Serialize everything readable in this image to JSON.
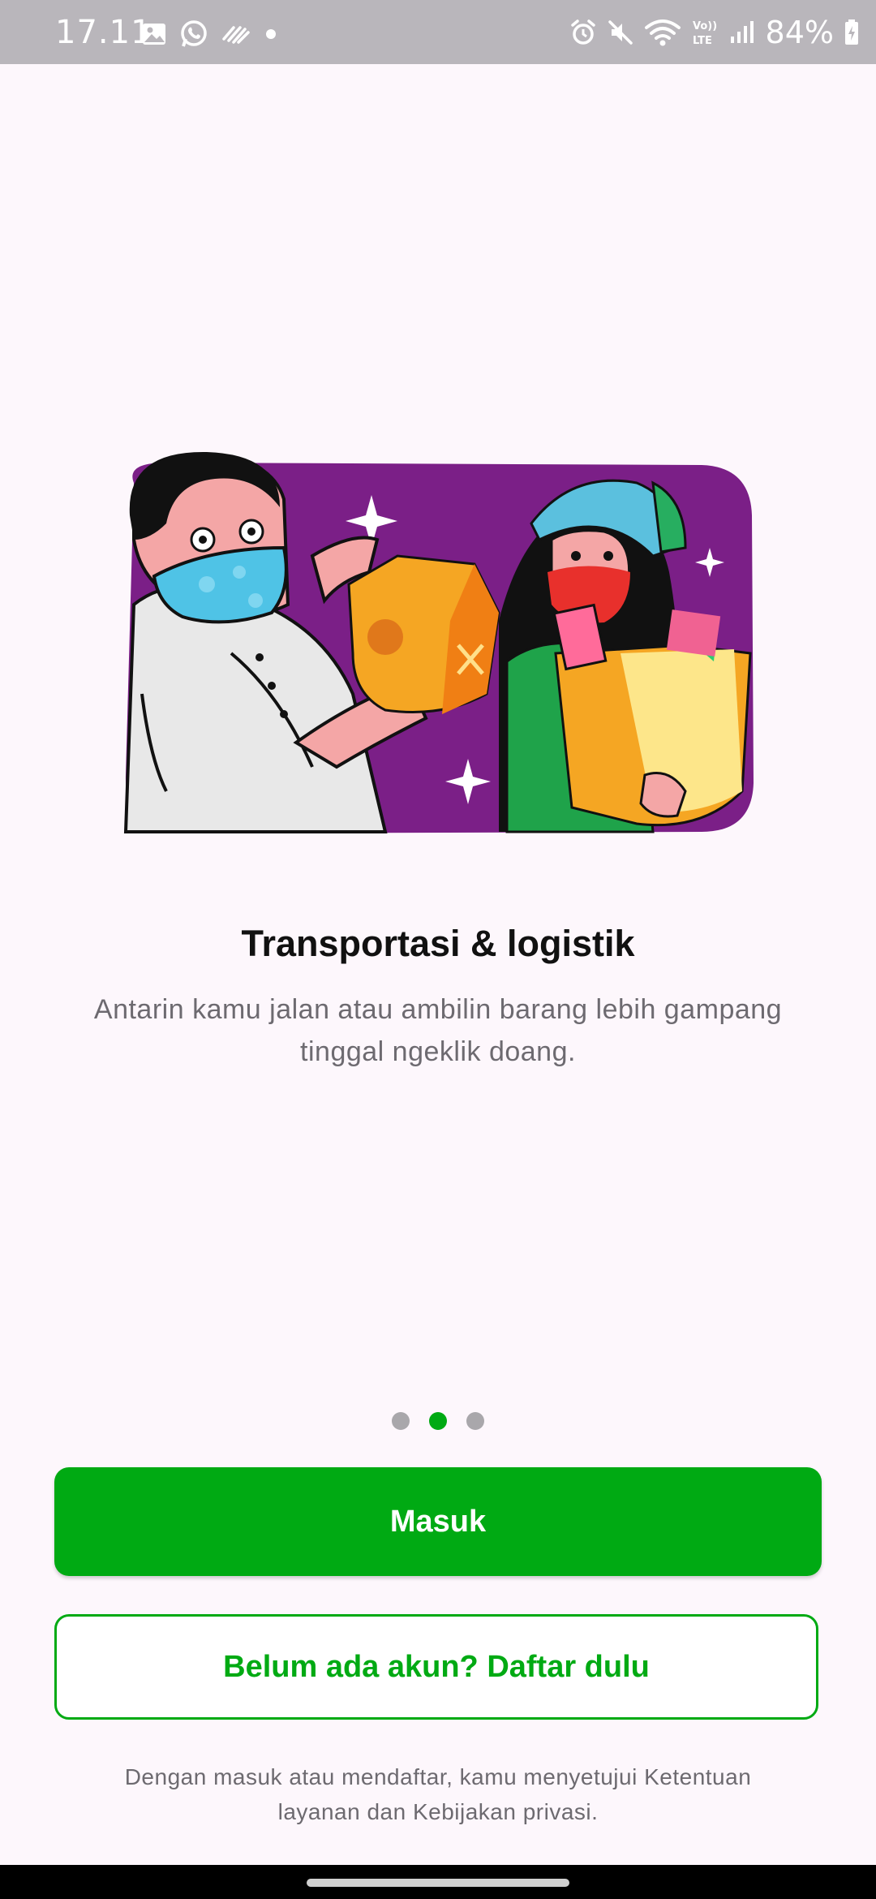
{
  "status_bar": {
    "time": "17.11",
    "battery": "84%",
    "icons_left": [
      "gallery-icon",
      "whatsapp-icon",
      "app-notification-icon",
      "dot-icon"
    ],
    "icons_right": [
      "alarm-icon",
      "mute-icon",
      "wifi-icon",
      "volte-icon",
      "signal-icon",
      "battery-icon"
    ]
  },
  "onboarding": {
    "title": "Transportasi & logistik",
    "subtitle": "Antarin kamu jalan atau ambilin barang lebih gampang tinggal ngeklik doang.",
    "page_count": 3,
    "active_page": 2
  },
  "actions": {
    "login_label": "Masuk",
    "register_label": "Belum ada akun? Daftar dulu"
  },
  "terms": "Dengan masuk atau mendaftar, kamu menyetujui Ketentuan layanan dan Kebijakan privasi.",
  "colors": {
    "accent": "#00aa13",
    "background": "#fdf7fc",
    "illustration_bg": "#7b1f87"
  }
}
